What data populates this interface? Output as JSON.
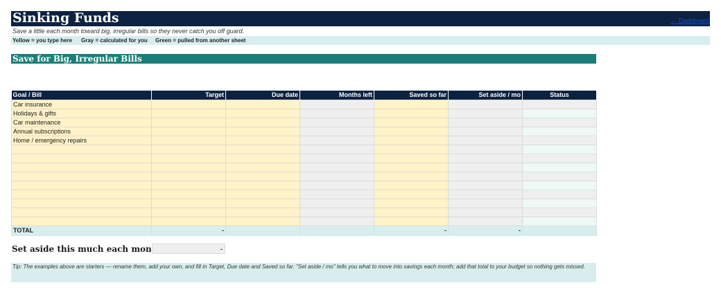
{
  "header": {
    "title": "Sinking Funds",
    "link_text": "← Dashboard",
    "subtitle": "Save a little each month toward big, irregular bills so they never catch you off guard.",
    "legend": {
      "yellow": "Yellow = you type here",
      "gray": "Gray = calculated for you",
      "green": "Green = pulled from another sheet"
    }
  },
  "section": {
    "title": "Save for Big, Irregular Bills"
  },
  "table": {
    "columns": [
      "Goal / Bill",
      "Target",
      "Due date",
      "Months left",
      "Saved so far",
      "Set aside / mo",
      "Status"
    ],
    "rows": [
      [
        "Car insurance",
        "",
        "",
        "",
        "",
        "",
        ""
      ],
      [
        "Holidays & gifts",
        "",
        "",
        "",
        "",
        "",
        ""
      ],
      [
        "Car maintenance",
        "",
        "",
        "",
        "",
        "",
        ""
      ],
      [
        "Annual subscriptions",
        "",
        "",
        "",
        "",
        "",
        ""
      ],
      [
        "Home / emergency repairs",
        "",
        "",
        "",
        "",
        "",
        ""
      ],
      [
        "",
        "",
        "",
        "",
        "",
        "",
        ""
      ],
      [
        "",
        "",
        "",
        "",
        "",
        "",
        ""
      ],
      [
        "",
        "",
        "",
        "",
        "",
        "",
        ""
      ],
      [
        "",
        "",
        "",
        "",
        "",
        "",
        ""
      ],
      [
        "",
        "",
        "",
        "",
        "",
        "",
        ""
      ],
      [
        "",
        "",
        "",
        "",
        "",
        "",
        ""
      ],
      [
        "",
        "",
        "",
        "",
        "",
        "",
        ""
      ],
      [
        "",
        "",
        "",
        "",
        "",
        "",
        ""
      ],
      [
        "",
        "",
        "",
        "",
        "",
        "",
        ""
      ]
    ],
    "total": [
      "TOTAL",
      "-",
      "",
      "",
      "-",
      "-",
      ""
    ]
  },
  "monthly": {
    "label": "Set aside this much each month",
    "value": "-"
  },
  "tip": "Tip: The examples above are starters — rename them, add your own, and fill in Target, Due date and Saved so far. \"Set aside / mo\" tells you what to move into savings each month; add that total to your budget so nothing gets missed.",
  "colors": {
    "navy": "#0d2240",
    "teal": "#1b7f79",
    "input_yellow": "#fff3c9",
    "calc_gray": "#efefef",
    "linked_green": "#eef8f5",
    "light_teal": "#d8eeee"
  }
}
